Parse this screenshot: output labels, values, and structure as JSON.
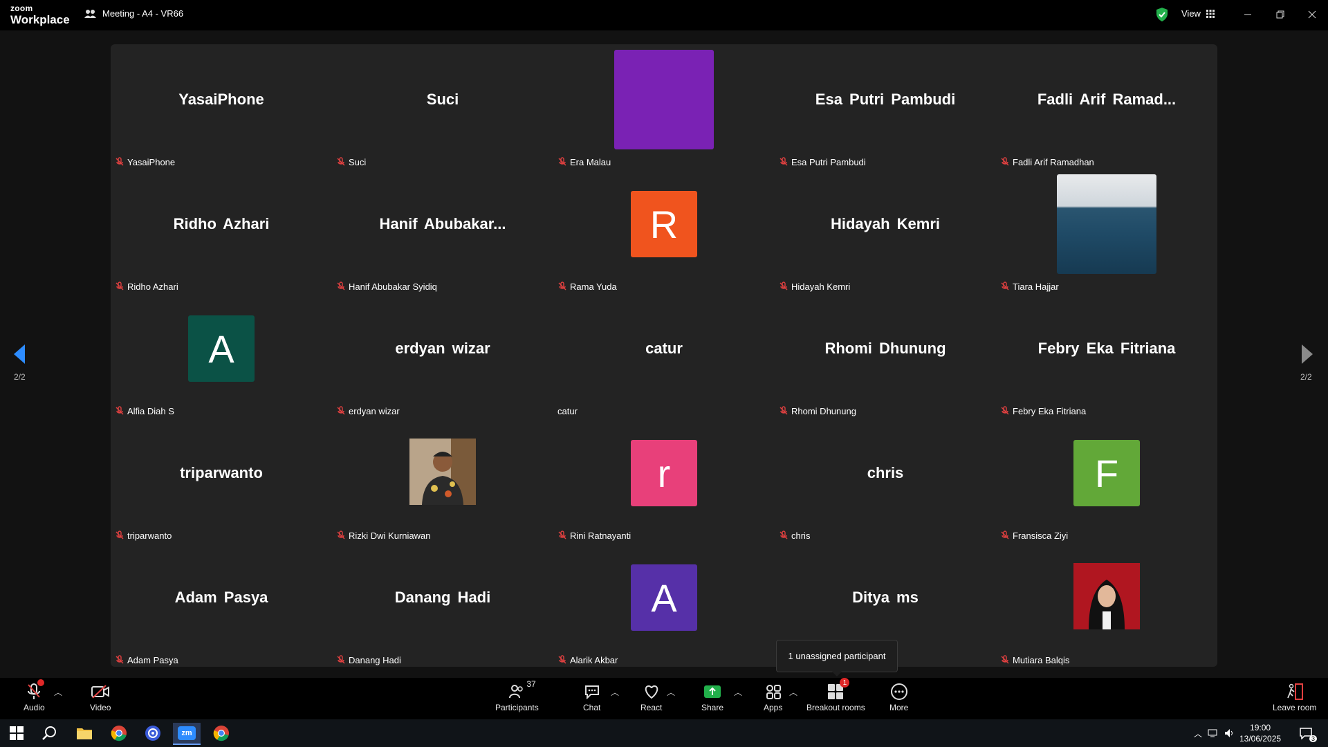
{
  "app": {
    "logo_top": "zoom",
    "logo_bottom": "Workplace",
    "meeting_title": "Meeting - A4 - VR66",
    "view_label": "View"
  },
  "colors": {
    "shield": "#22b04b",
    "share": "#22b04b",
    "badge": "#e02828",
    "mute": "#e04040"
  },
  "page_indicator_left": "2/2",
  "page_indicator_right": "2/2",
  "participants": [
    {
      "display": "YasaiPhone",
      "label": "YasaiPhone",
      "muted": true
    },
    {
      "display": "Suci",
      "label": "Suci",
      "muted": true
    },
    {
      "display": "",
      "label": "Era Malau",
      "muted": true,
      "avatar_letter": "",
      "avatar_color": "#7a22b4",
      "avatar_size": "big"
    },
    {
      "display": "Esa Putri Pambudi",
      "label": "Esa Putri Pambudi",
      "muted": true
    },
    {
      "display": "Fadli Arif Ramad...",
      "label": "Fadli Arif Ramadhan",
      "muted": true
    },
    {
      "display": "Ridho Azhari",
      "label": "Ridho Azhari",
      "muted": true
    },
    {
      "display": "Hanif Abubakar...",
      "label": "Hanif Abubakar Syidiq",
      "muted": true
    },
    {
      "display": "",
      "label": "Rama Yuda",
      "muted": true,
      "avatar_letter": "R",
      "avatar_color": "#f0541e"
    },
    {
      "display": "Hidayah Kemri",
      "label": "Hidayah Kemri",
      "muted": true
    },
    {
      "display": "",
      "label": "Tiara Hajjar",
      "muted": true,
      "photo": "sea",
      "avatar_size": "big"
    },
    {
      "display": "",
      "label": "Alfia Diah S",
      "muted": true,
      "avatar_letter": "A",
      "avatar_color": "#0b5246"
    },
    {
      "display": "erdyan wizar",
      "label": "erdyan wizar",
      "muted": true
    },
    {
      "display": "catur",
      "label": "catur",
      "muted": false
    },
    {
      "display": "Rhomi Dhunung",
      "label": "Rhomi Dhunung",
      "muted": true
    },
    {
      "display": "Febry Eka Fitriana",
      "label": "Febry Eka Fitriana",
      "muted": true
    },
    {
      "display": "triparwanto",
      "label": "triparwanto",
      "muted": true
    },
    {
      "display": "",
      "label": "Rizki Dwi Kurniawan",
      "muted": true,
      "photo": "person"
    },
    {
      "display": "",
      "label": "Rini Ratnayanti",
      "muted": true,
      "avatar_letter": "r",
      "avatar_color": "#e8407a"
    },
    {
      "display": "chris",
      "label": "chris",
      "muted": true
    },
    {
      "display": "",
      "label": "Fransisca Ziyi",
      "muted": true,
      "avatar_letter": "F",
      "avatar_color": "#62a838"
    },
    {
      "display": "Adam Pasya",
      "label": "Adam Pasya",
      "muted": true
    },
    {
      "display": "Danang Hadi",
      "label": "Danang Hadi",
      "muted": true
    },
    {
      "display": "",
      "label": "Alarik Akbar",
      "muted": true,
      "avatar_letter": "A",
      "avatar_color": "#5630a8"
    },
    {
      "display": "Ditya ms",
      "label": "",
      "muted": false
    },
    {
      "display": "",
      "label": "Mutiara Balqis",
      "muted": true,
      "photo": "hijab"
    }
  ],
  "tooltip": "1 unassigned participant",
  "toolbar": {
    "audio": "Audio",
    "video": "Video",
    "participants": "Participants",
    "participants_count": "37",
    "chat": "Chat",
    "react": "React",
    "share": "Share",
    "apps": "Apps",
    "breakout": "Breakout rooms",
    "breakout_badge": "1",
    "more": "More",
    "leave": "Leave room"
  },
  "taskbar": {
    "icons": [
      "windows-start-icon",
      "search-icon",
      "file-explorer-icon",
      "chrome-icon",
      "browser-icon",
      "zoom-taskbar-icon",
      "chrome-icon"
    ],
    "zoom_label": "zm",
    "time": "19:00",
    "date": "13/06/2025",
    "notification_count": "3"
  }
}
